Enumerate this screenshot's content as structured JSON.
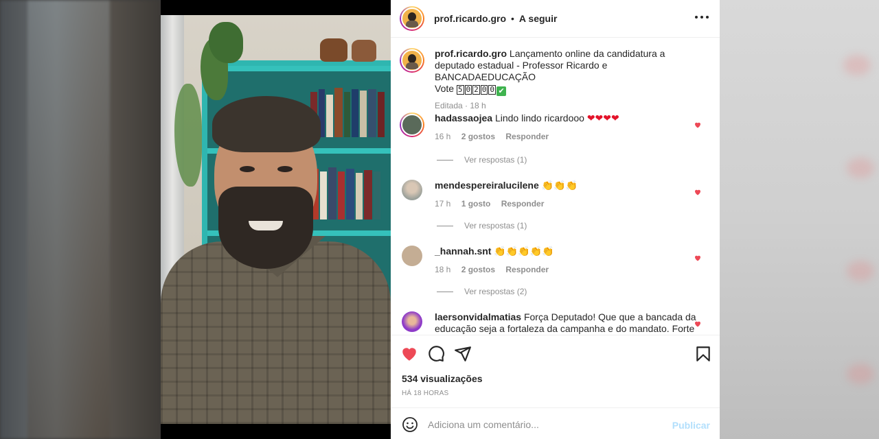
{
  "header": {
    "username": "prof.ricardo.gro",
    "separator": "•",
    "follow_label": "A seguir",
    "more_icon": "more-horizontal-icon"
  },
  "caption": {
    "username": "prof.ricardo.gro",
    "text": "Lançamento online da candidatura a deputado estadual - Professor Ricardo e BANCADAEDUCAÇÃO",
    "vote_label": "Vote",
    "vote_digits": [
      "5",
      "0",
      "2",
      "0",
      "0"
    ],
    "check": "✔",
    "edited": "Editada · 18 h"
  },
  "comments": [
    {
      "username": "hadassaojea",
      "text": "Lindo lindo ricardooo",
      "emojis": "❤❤❤❤",
      "time": "16 h",
      "likes": "2 gostos",
      "reply": "Responder",
      "view_replies": "Ver respostas (1)"
    },
    {
      "username": "mendespereiralucilene",
      "text": "",
      "emojis": "👏👏👏",
      "time": "17 h",
      "likes": "1 gosto",
      "reply": "Responder",
      "view_replies": "Ver respostas (1)"
    },
    {
      "username": "_hannah.snt",
      "text": "",
      "emojis": "👏👏👏👏👏",
      "time": "18 h",
      "likes": "2 gostos",
      "reply": "Responder",
      "view_replies": "Ver respostas (2)"
    },
    {
      "username": "laersonvidalmatias",
      "text": "Força Deputado! Que que a bancada da educação seja a fortaleza da campanha e do mandato. Forte"
    }
  ],
  "actions": {
    "views": "534 visualizações",
    "posted_ago": "HÁ 18 HORAS"
  },
  "composer": {
    "placeholder": "Adiciona um comentário...",
    "publish_label": "Publicar"
  },
  "colors": {
    "like_red": "#ed4956",
    "text": "#262626",
    "muted": "#8e8e8e",
    "publish_disabled": "#b2dffc"
  }
}
